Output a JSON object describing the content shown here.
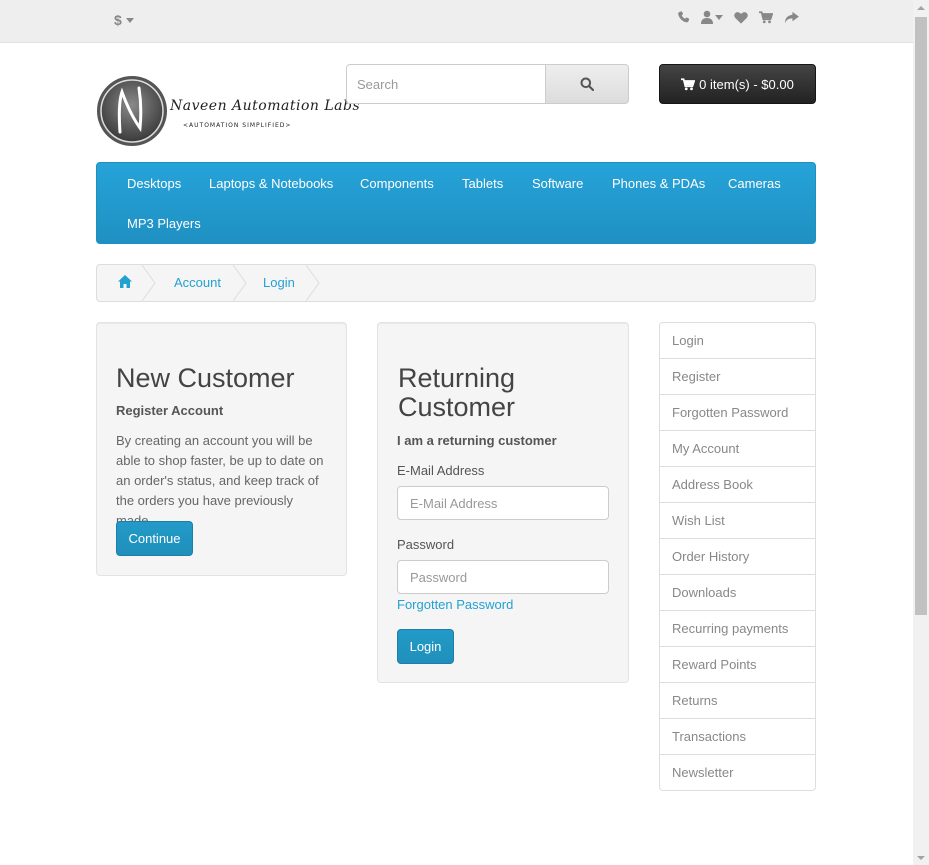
{
  "topbar": {
    "currency_symbol": "$",
    "icons": [
      "phone-icon",
      "user-icon",
      "heart-icon",
      "shopping-cart-icon",
      "share-icon"
    ]
  },
  "header": {
    "logo_title": "Naveen Automation Labs",
    "logo_subtitle": "<AUTOMATION SIMPLIFIED>",
    "search_placeholder": "Search",
    "cart_label": "0 item(s) - $0.00"
  },
  "menu": {
    "items": [
      "Desktops",
      "Laptops & Notebooks",
      "Components",
      "Tablets",
      "Software",
      "Phones & PDAs",
      "Cameras",
      "MP3 Players"
    ]
  },
  "breadcrumb": {
    "items": [
      "Account",
      "Login"
    ]
  },
  "new_customer": {
    "title": "New Customer",
    "subtitle": "Register Account",
    "text": "By creating an account you will be able to shop faster, be up to date on an order's status, and keep track of the orders you have previously made.",
    "button": "Continue"
  },
  "returning_customer": {
    "title_line1": "Returning",
    "title_line2": "Customer",
    "subtitle": "I am a returning customer",
    "email_label": "E-Mail Address",
    "email_placeholder": "E-Mail Address",
    "password_label": "Password",
    "password_placeholder": "Password",
    "forgotten_link": "Forgotten Password",
    "button": "Login"
  },
  "account_links": [
    "Login",
    "Register",
    "Forgotten Password",
    "My Account",
    "Address Book",
    "Wish List",
    "Order History",
    "Downloads",
    "Recurring payments",
    "Reward Points",
    "Returns",
    "Transactions",
    "Newsletter"
  ]
}
